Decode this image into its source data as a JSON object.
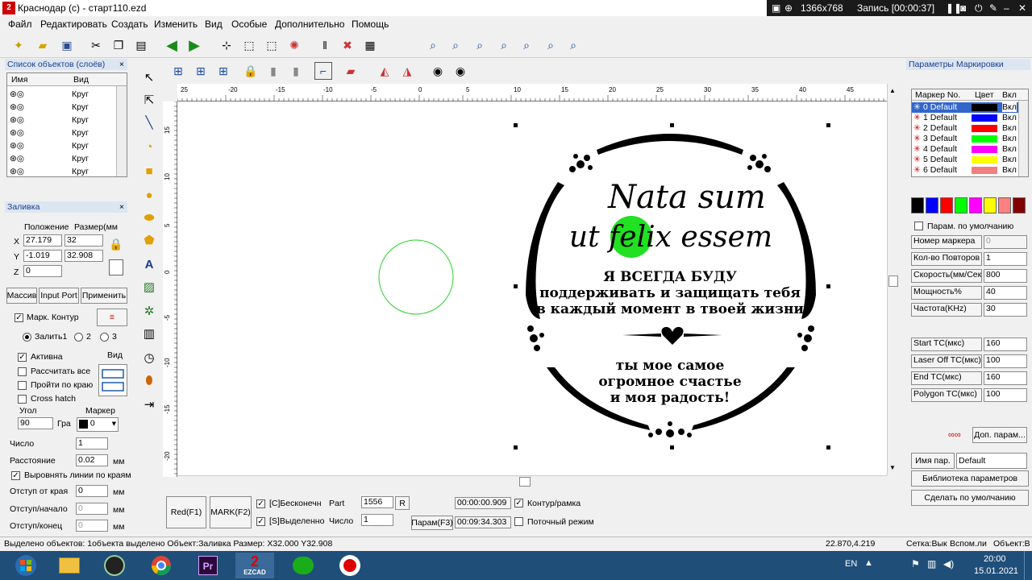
{
  "titlebar": {
    "title": "Краснодар (c) - старт110.ezd"
  },
  "recorder": {
    "resolution": "1366x768",
    "recording": "Запись [00:00:37]"
  },
  "menu": [
    "Файл",
    "Редактировать",
    "Создать",
    "Изменить",
    "Вид",
    "Особые",
    "Дополнительно",
    "Помощь"
  ],
  "object_list": {
    "title": "Список объектов (слоёв)",
    "col_name": "Имя",
    "col_type": "Вид",
    "rows": [
      "Круг",
      "Круг",
      "Круг",
      "Круг",
      "Круг",
      "Круг",
      "Круг"
    ]
  },
  "fill_panel": {
    "title": "Заливка",
    "pos_label": "Положение",
    "size_label": "Размер(мм",
    "x_label": "X",
    "y_label": "Y",
    "z_label": "Z",
    "x_pos": "27.179",
    "x_size": "32",
    "y_pos": "-1.019",
    "y_size": "32.908",
    "z_pos": "0",
    "btn_array": "Массив",
    "btn_input": "Input Port",
    "btn_apply": "Применить",
    "mark_contour": "Марк. Контур",
    "fill1": "Залить1",
    "fill2": "2",
    "fill3": "3",
    "active": "Активна",
    "view": "Вид",
    "calc_all": "Рассчитать все",
    "along_edge": "Пройти по краю",
    "cross_hatch": "Cross hatch",
    "angle_label": "Угол",
    "angle_value": "90",
    "angle_unit": "Гра",
    "marker_label": "Маркер",
    "marker_value": "0",
    "count_label": "Число",
    "count_value": "1",
    "distance_label": "Расстояние",
    "distance_value": "0.02",
    "mm": "мм",
    "align_lines": "Выровнять линии по краям",
    "edge_offset_label": "Отступ от края",
    "edge_offset_value": "0",
    "start_offset_label": "Отступ/начало",
    "start_offset_value": "0",
    "end_offset_label": "Отступ/конец",
    "end_offset_value": "0"
  },
  "ruler": {
    "top_ticks": [
      "25",
      "-20",
      "-15",
      "-10",
      "-5",
      "0",
      "5",
      "10",
      "15",
      "20",
      "25",
      "30",
      "35",
      "40",
      "45"
    ],
    "left_ticks": [
      "15",
      "10",
      "5",
      "0",
      "-5",
      "-10",
      "-15",
      "-20"
    ]
  },
  "design": {
    "line1": "Nata sum",
    "line2": "ut felix essem",
    "line3": "Я ВСЕГДА БУДУ",
    "line4": "поддерживать и защищать тебя",
    "line5": "в каждый момент в твоей жизни",
    "line6": "ты мое самое",
    "line7": "огромное счастье",
    "line8": "и моя радость!"
  },
  "bottom_controls": {
    "red_btn": "Red(F1)",
    "mark_btn": "MARK(F2)",
    "infinite": "[C]Бесконечн",
    "selected": "[S]Выделенно",
    "part_label": "Part",
    "part_value": "1556",
    "r_btn": "R",
    "count_label": "Число",
    "count_value": "1",
    "time1": "00:00:00.909",
    "time2": "00:09:34.303",
    "contour": "Контур/рамка",
    "flow": "Поточный режим",
    "params_btn": "Парам(F3)"
  },
  "mark_params": {
    "title": "Параметры Маркировки",
    "col_no": "Маркер No.",
    "col_color": "Цвет",
    "col_on": "Вкл",
    "pens": [
      {
        "name": "0 Default",
        "color": "#000000",
        "on": "Вкл"
      },
      {
        "name": "1 Default",
        "color": "#0000ff",
        "on": "Вкл"
      },
      {
        "name": "2 Default",
        "color": "#ff0000",
        "on": "Вкл"
      },
      {
        "name": "3 Default",
        "color": "#00ff00",
        "on": "Вкл"
      },
      {
        "name": "4 Default",
        "color": "#ff00ff",
        "on": "Вкл"
      },
      {
        "name": "5 Default",
        "color": "#ffff00",
        "on": "Вкл"
      },
      {
        "name": "6 Default",
        "color": "#f08080",
        "on": "Вкл"
      }
    ],
    "palette": [
      "#000000",
      "#0000ff",
      "#ff0000",
      "#00ff00",
      "#ff00ff",
      "#ffff00",
      "#ff8080",
      "#800000"
    ],
    "default_params": "Парам. по умолчанию",
    "marker_no_label": "Номер маркера",
    "marker_no": "0",
    "repeat_label": "Кол-во Повторов",
    "repeat": "1",
    "speed_label": "Скорость(мм/Сек",
    "speed": "800",
    "power_label": "Мощность%",
    "power": "40",
    "freq_label": "Частота(KHz)",
    "freq": "30",
    "start_tc_label": "Start TC(мкс)",
    "start_tc": "160",
    "laser_off_label": "Laser Off TC(мкс)",
    "laser_off": "100",
    "end_tc_label": "End TC(мкс)",
    "end_tc": "160",
    "polygon_tc_label": "Polygon TC(мкс)",
    "polygon_tc": "100",
    "more_btn": "Доп. парам...",
    "param_name_label": "Имя пар.",
    "param_name": "Default",
    "library_btn": "Библиотека параметров",
    "set_default_btn": "Сделать по умолчанию"
  },
  "status": {
    "message": "Выделено объектов: 1объекта выделено Объект:Заливка Размер: X32.000 Y32.908",
    "coords": "22.870,4.219",
    "grid": "Сетка:Вык",
    "snap": "Вспом.ли",
    "object": "Объект:В"
  },
  "taskbar": {
    "lang": "EN",
    "time": "20:00",
    "date": "15.01.2021",
    "ezcad_label": "EZCAD"
  }
}
